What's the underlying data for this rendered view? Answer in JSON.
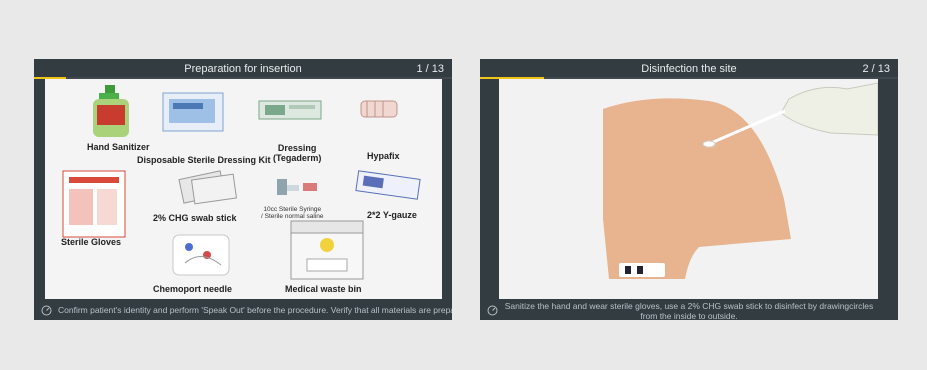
{
  "slides": [
    {
      "title": "Preparation for insertion",
      "counter": "1 / 13",
      "progress": 0.077,
      "caption": "Confirm patient's identity and perform 'Speak Out' before the procedure. Verify that all materials are prepared.",
      "items": [
        "Hand Sanitizer",
        "Disposable Sterile Dressing Kit",
        "Dressing\n(Tegaderm)",
        "Hypafix",
        "Sterile Gloves",
        "2% CHG swab stick",
        "10cc Sterile Syringe\n/ Sterile normal saline",
        "2*2 Y-gauze",
        "Chemoport needle",
        "Medical waste bin"
      ]
    },
    {
      "title": "Disinfection the site",
      "counter": "2 / 13",
      "progress": 0.154,
      "caption": "Sanitize the hand and wear sterile gloves, use a 2% CHG swab stick to disinfect by drawingcircles from the inside to outside."
    }
  ],
  "colors": {
    "panel": "#333c41",
    "progress": "#f0c419",
    "background": "#e9e9e9"
  }
}
